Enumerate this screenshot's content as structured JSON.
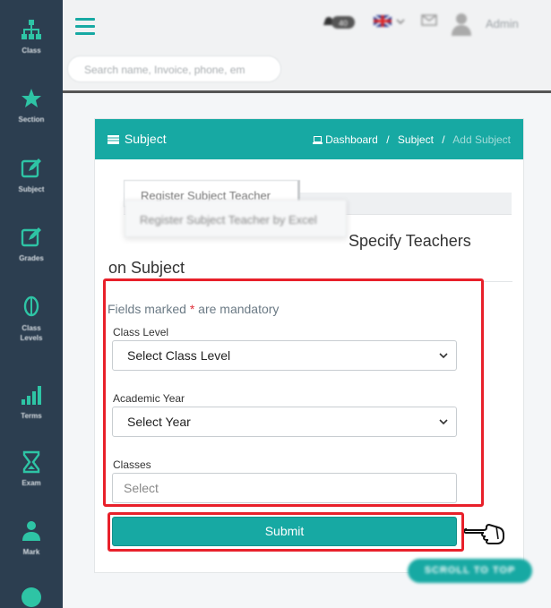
{
  "sidebar": {
    "items": [
      {
        "label": "Class",
        "icon": "sitemap-icon"
      },
      {
        "label": "Section",
        "icon": "star-icon"
      },
      {
        "label": "Subject",
        "icon": "edit-icon"
      },
      {
        "label": "Grades",
        "icon": "edit-icon"
      },
      {
        "label": "Class Levels",
        "icon": "dollar-icon"
      },
      {
        "label": "Terms",
        "icon": "signal-icon"
      },
      {
        "label": "Exam",
        "icon": "hourglass-icon"
      },
      {
        "label": "Mark",
        "icon": "user-tie-icon"
      }
    ]
  },
  "topbar": {
    "search_placeholder": "Search name, Invoice, phone, em",
    "notification_count": "40",
    "user_label": "Admin"
  },
  "card": {
    "title": "Subject",
    "breadcrumb": {
      "dashboard": "Dashboard",
      "subject": "Subject",
      "current": "Add Subject",
      "sep": "/"
    }
  },
  "tabs": {
    "register": "Register Subject Teacher",
    "register_excel": "Register Subject Teacher by Excel"
  },
  "heading": {
    "line1": "Specify Teachers",
    "line2": "on Subject"
  },
  "form": {
    "mandatory_prefix": "Fields marked",
    "mandatory_star": "*",
    "mandatory_suffix": "are mandatory",
    "class_level_label": "Class Level",
    "class_level_value": "Select Class Level",
    "academic_year_label": "Academic Year",
    "academic_year_value": "Select Year",
    "classes_label": "Classes",
    "classes_placeholder": "Select",
    "submit_label": "Submit"
  },
  "scroll_top": "SCROLL TO TOP",
  "colors": {
    "accent": "#17a9a3",
    "sidebar": "#2c3e50",
    "highlight": "#e8202a"
  }
}
